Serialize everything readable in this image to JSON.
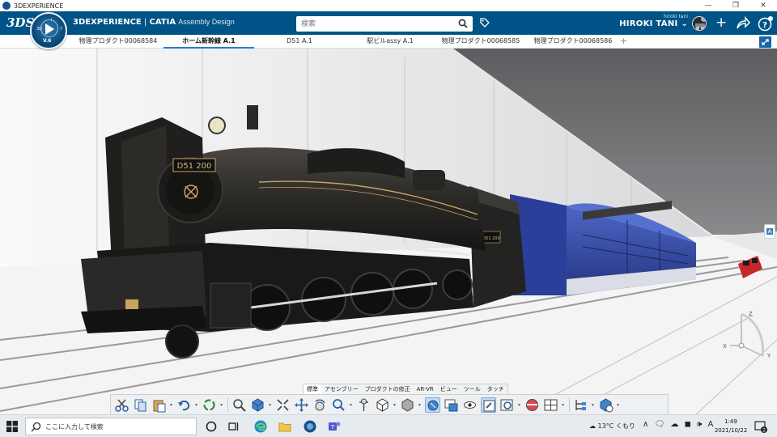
{
  "window": {
    "title": "3DEXPERIENCE",
    "controls": [
      "—",
      "❐",
      "✕"
    ]
  },
  "app": {
    "brand_bold": "3DEXPERIENCE",
    "brand_sep": " | ",
    "brand_product": "CATIA",
    "brand_app": "Assembly Design",
    "compass_version": "V.6",
    "compass_quadrants": [
      "3D",
      "i",
      "f"
    ],
    "search_placeholder": "検索",
    "user_small": "hiroki tani",
    "user_name": "HIROKI TANI"
  },
  "tabs": [
    {
      "label": "物理プロダクト00068584",
      "active": false
    },
    {
      "label": "ホーム新幹線 A.1",
      "active": true
    },
    {
      "label": "D51 A.1",
      "active": false
    },
    {
      "label": "駅ビルassy A.1",
      "active": false
    },
    {
      "label": "物理プロダクト00068585",
      "active": false
    },
    {
      "label": "物理プロダクト00068586",
      "active": false
    }
  ],
  "tab_add": "+",
  "scene": {
    "locomotive_plate": "D51 200",
    "cab_plate": "D51 200",
    "compass_axes": {
      "z": "Z",
      "x": "X",
      "y": "Y"
    },
    "colors": {
      "loco": "#2b2b2b",
      "coaches": "#3b55b5",
      "ceiling": "#6e6e70",
      "floor": "#f4f4f5",
      "express": "#c7262c"
    }
  },
  "action_bar": {
    "tabs": [
      {
        "label": "標準",
        "active": true
      },
      {
        "label": "アセンブリー",
        "active": false
      },
      {
        "label": "プロダクトの修正",
        "active": false
      },
      {
        "label": "AR-VR",
        "active": false
      },
      {
        "label": "ビュー",
        "active": false
      },
      {
        "label": "ツール",
        "active": false
      },
      {
        "label": "タッチ",
        "active": false
      }
    ],
    "tools": [
      "cut-icon",
      "copy-icon",
      "paste-icon",
      "undo-icon",
      "update-icon",
      "zoom-area-icon",
      "fit-all-icon",
      "pan-icon",
      "rotate-icon",
      "zoom-icon",
      "normal-view-icon",
      "iso-view-icon",
      "render-style-icon",
      "shading-icon",
      "capture-icon",
      "hide-show-icon",
      "swap-visible-icon",
      "refresh-icon",
      "material-icon",
      "layout-icon",
      "tree-icon",
      "insert-product-icon"
    ]
  },
  "taskbar": {
    "search_placeholder": "ここに入力して検索",
    "weather": "13°C くもり",
    "tray_icons": "∧ 🗨 ☁ ◼ 🕪 A",
    "time": "1:49",
    "date": "2021/10/22",
    "notif_count": "2"
  }
}
